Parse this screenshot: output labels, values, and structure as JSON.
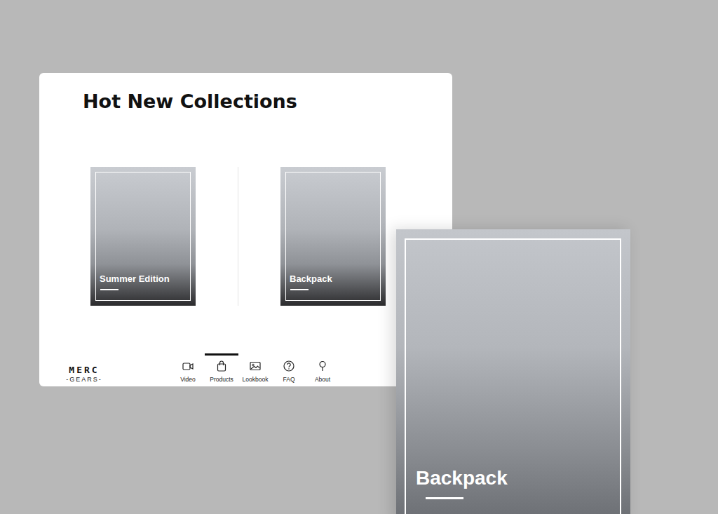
{
  "window": {
    "title": "Hot New Collections"
  },
  "products": [
    {
      "label": "Summer Edition"
    },
    {
      "label": "Backpack"
    }
  ],
  "logo": {
    "top": "MERC",
    "bottom": "-GEARS-"
  },
  "nav": [
    {
      "label": "Video",
      "selected": false,
      "kind": "video"
    },
    {
      "label": "Products",
      "selected": true,
      "kind": "bag"
    },
    {
      "label": "Lookbook",
      "selected": false,
      "kind": "image"
    },
    {
      "label": "FAQ",
      "selected": false,
      "kind": "question"
    },
    {
      "label": "About",
      "selected": false,
      "kind": "pin"
    }
  ],
  "feature": {
    "label": "Backpack"
  }
}
